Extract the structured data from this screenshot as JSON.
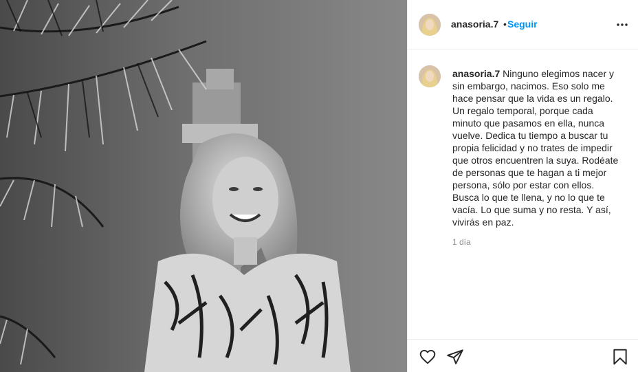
{
  "post": {
    "username": "anasoria.7",
    "separator": "•",
    "follow_label": "Seguir",
    "more_icon": "more-options-icon",
    "caption_username": "anasoria.7",
    "caption_text": "Ninguno elegimos nacer y\nsin embargo, nacimos. Eso solo me\nhace pensar que la vida es un regalo.\nUn regalo temporal, porque cada\nminuto que pasamos en ella, nunca\nvuelve. Dedica tu tiempo a buscar tu\npropia felicidad y no trates de impedir\nque otros encuentren la suya. Rodéate\nde personas que te hagan a ti mejor\npersona, sólo por estar con ellos.\nBusca lo que te llena, y no lo que te\nvacía. Lo que suma y no resta. Y así,\nvivirás en paz.",
    "timestamp": "1 día"
  },
  "actions": {
    "like_icon": "heart-icon",
    "share_icon": "paper-plane-icon",
    "save_icon": "bookmark-icon"
  },
  "colors": {
    "link_blue": "#0095f6",
    "text": "#262626",
    "muted": "#8e8e8e",
    "border": "#efefef"
  }
}
